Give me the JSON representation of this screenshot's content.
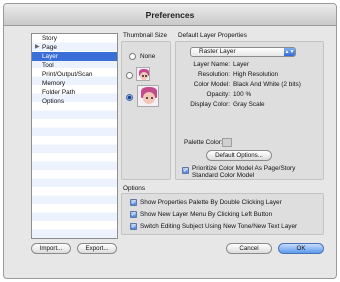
{
  "window": {
    "title": "Preferences"
  },
  "sidebar": {
    "items": [
      {
        "label": "Story",
        "selected": false,
        "expandable": false
      },
      {
        "label": "Page",
        "selected": false,
        "expandable": true
      },
      {
        "label": "Layer",
        "selected": true,
        "expandable": false
      },
      {
        "label": "Tool",
        "selected": false,
        "expandable": false
      },
      {
        "label": "Print/Output/Scan",
        "selected": false,
        "expandable": false
      },
      {
        "label": "Memory",
        "selected": false,
        "expandable": false
      },
      {
        "label": "Folder Path",
        "selected": false,
        "expandable": false
      },
      {
        "label": "Options",
        "selected": false,
        "expandable": false
      }
    ]
  },
  "thumbnail": {
    "heading": "Thumbnail Size",
    "none_label": "None",
    "selected_option": "large"
  },
  "layer_props": {
    "heading": "Default Layer Properties",
    "layer_type": "Raster Layer",
    "fields": [
      {
        "label": "Layer Name:",
        "value": "Layer"
      },
      {
        "label": "Resolution:",
        "value": "High Resolution"
      },
      {
        "label": "Color Model:",
        "value": "Black And White (2 bits)"
      },
      {
        "label": "Opacity:",
        "value": "100 %"
      },
      {
        "label": "Display Color:",
        "value": "Gray Scale"
      }
    ],
    "palette_color_label": "Palette Color:",
    "default_options_button": "Default Options...",
    "prioritize_line1": "Prioritize Color Model As Page/Story",
    "prioritize_line2": "Standard Color Model",
    "prioritize_checked": true
  },
  "options": {
    "heading": "Options",
    "checkboxes": [
      {
        "label": "Show Properties Palette By Double Clicking Layer",
        "checked": true
      },
      {
        "label": "Show New Layer Menu By Clicking Left Button",
        "checked": true
      },
      {
        "label": "Switch Editing Subject Using New Tone/New Text Layer",
        "checked": true
      }
    ]
  },
  "footer": {
    "import_label": "Import...",
    "export_label": "Export...",
    "cancel_label": "Cancel",
    "ok_label": "OK"
  },
  "colors": {
    "selection": "#3b6fd8",
    "primary_button": "#5a9aee"
  }
}
